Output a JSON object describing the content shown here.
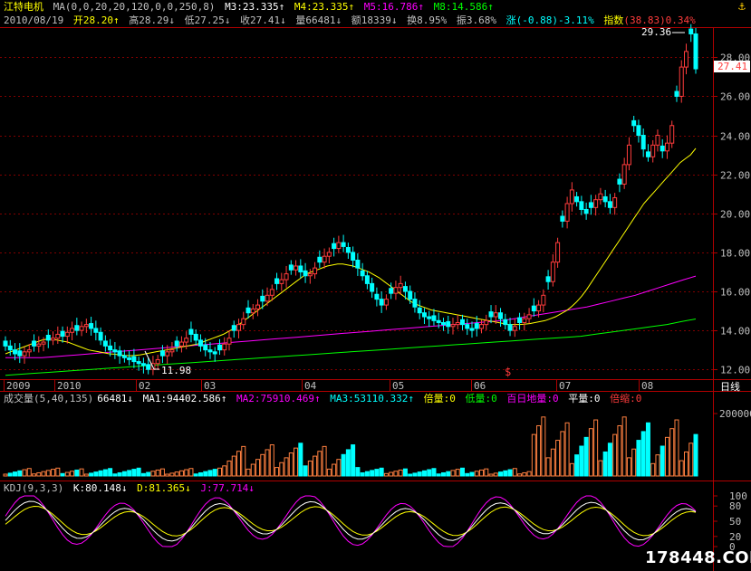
{
  "header": {
    "stock_name": "江特电机",
    "ma_params": "MA(0,0,20,20,120,0,0,250,8)",
    "ma3": "M3:23.335↑",
    "ma4": "M4:23.335↑",
    "ma5": "M5:16.786↑",
    "ma8": "M8:14.586↑"
  },
  "info_row": {
    "date": "2010/08/19",
    "open": "开28.20↑",
    "high": "高28.29↓",
    "low": "低27.25↓",
    "close": "收27.41↓",
    "volume": "量66481↓",
    "amount": "额18339↓",
    "turnover": "换8.95%",
    "amplitude": "振3.68%",
    "change": "涨(-0.88)-3.11%",
    "index_label": "指数",
    "index_value": "(38.83)0.34%"
  },
  "price_axis": [
    "28.00",
    "26.00",
    "24.00",
    "22.00",
    "20.00",
    "18.00",
    "16.00",
    "14.00",
    "12.00"
  ],
  "current_price_tag": "27.41",
  "high_annotation": "29.36",
  "low_annotation": "11.98",
  "time_axis": [
    "2009",
    "2010",
    "02",
    "03",
    "04",
    "05",
    "06",
    "07",
    "08"
  ],
  "dollar_marker": "$",
  "period_label": "日线",
  "volume_header": {
    "name": "成交量(5,40,135)",
    "value": "66481↓",
    "ma1": "MA1:94402.586↑",
    "ma2": "MA2:75910.469↑",
    "ma3": "MA3:53110.332↑",
    "double": "倍量:0",
    "low_vol": "低量:0",
    "hundred_day": "百日地量:0",
    "flat": "平量:0",
    "shrink": "倍缩:0"
  },
  "volume_axis": [
    "200000"
  ],
  "kdj_header": {
    "name": "KDJ(9,3,3)",
    "k": "K:80.148↓",
    "d": "D:81.365↓",
    "j": "J:77.714↓"
  },
  "kdj_axis": [
    "100",
    "80",
    "50",
    "20",
    "0"
  ],
  "watermark": "178448.COM",
  "colors": {
    "up": "#ff3c3c",
    "down": "#00ffff",
    "ma20": "#ffff00",
    "ma120": "#ff00ff",
    "ma250": "#00ff00",
    "grid": "#800000",
    "frame": "#b00000"
  },
  "chart_data": {
    "type": "candlestick",
    "panels": [
      "price",
      "volume",
      "kdj"
    ],
    "price_ylim": [
      11.5,
      29.5
    ],
    "months": [
      "2009",
      "2010",
      "02",
      "03",
      "04",
      "05",
      "06",
      "07",
      "08"
    ],
    "closes": [
      13.2,
      13.0,
      12.8,
      12.7,
      12.9,
      13.0,
      13.2,
      13.3,
      13.4,
      13.5,
      13.6,
      13.8,
      13.7,
      13.9,
      14.1,
      14.0,
      14.2,
      14.3,
      14.1,
      13.9,
      13.5,
      13.2,
      13.0,
      12.9,
      12.7,
      12.6,
      12.5,
      12.4,
      12.3,
      12.2,
      12.0,
      12.3,
      12.5,
      12.7,
      12.9,
      13.0,
      13.2,
      13.4,
      13.6,
      13.8,
      13.5,
      13.2,
      13.0,
      12.9,
      12.8,
      13.0,
      13.3,
      13.6,
      14.0,
      14.3,
      14.6,
      14.9,
      15.1,
      15.3,
      15.5,
      15.8,
      16.1,
      16.4,
      16.6,
      16.9,
      17.1,
      17.3,
      17.0,
      16.8,
      16.9,
      17.2,
      17.5,
      17.8,
      18.0,
      18.2,
      18.5,
      18.3,
      18.0,
      17.6,
      17.2,
      16.8,
      16.4,
      16.0,
      15.6,
      15.3,
      15.6,
      15.9,
      16.2,
      16.4,
      16.0,
      15.6,
      15.2,
      14.9,
      14.7,
      14.6,
      14.5,
      14.4,
      14.3,
      14.2,
      14.3,
      14.4,
      14.3,
      14.1,
      14.0,
      14.1,
      14.3,
      14.5,
      14.7,
      14.9,
      14.6,
      14.3,
      14.0,
      14.2,
      14.4,
      14.6,
      14.8,
      15.0,
      15.3,
      15.8,
      16.5,
      17.5,
      18.5,
      19.6,
      20.5,
      21.2,
      20.6,
      20.2,
      20.0,
      20.3,
      20.7,
      21.0,
      20.6,
      20.3,
      20.8,
      21.5,
      22.5,
      23.5,
      24.5,
      24.0,
      23.3,
      22.9,
      23.5,
      24.0,
      23.2,
      23.6,
      24.5,
      26.0,
      27.5,
      28.3,
      29.2,
      27.41
    ],
    "ma20": [
      12.8,
      12.9,
      13.0,
      13.1,
      13.2,
      13.3,
      13.4,
      13.5,
      13.55,
      13.55,
      13.5,
      13.45,
      13.4,
      13.3,
      13.2,
      13.1,
      13.0,
      12.95,
      12.9,
      12.85,
      12.8,
      12.78,
      12.75,
      12.72,
      12.7,
      12.72,
      12.75,
      12.8,
      12.85,
      12.9,
      12.95,
      13.0,
      13.05,
      13.1,
      13.15,
      13.2,
      13.25,
      13.3,
      13.4,
      13.5,
      13.6,
      13.7,
      13.8,
      13.95,
      14.1,
      14.3,
      14.5,
      14.7,
      14.9,
      15.1,
      15.3,
      15.5,
      15.7,
      15.9,
      16.1,
      16.3,
      16.5,
      16.7,
      16.9,
      17.0,
      17.1,
      17.2,
      17.3,
      17.35,
      17.4,
      17.4,
      17.35,
      17.3,
      17.2,
      17.1,
      17.0,
      16.85,
      16.7,
      16.5,
      16.3,
      16.1,
      15.9,
      15.7,
      15.5,
      15.35,
      15.25,
      15.15,
      15.05,
      15.0,
      14.95,
      14.9,
      14.85,
      14.8,
      14.75,
      14.7,
      14.65,
      14.6,
      14.55,
      14.5,
      14.45,
      14.4,
      14.35,
      14.3,
      14.3,
      14.3,
      14.32,
      14.35,
      14.4,
      14.45,
      14.5,
      14.6,
      14.7,
      14.85,
      15.0,
      15.2,
      15.45,
      15.75,
      16.1,
      16.5,
      16.9,
      17.3,
      17.7,
      18.1,
      18.5,
      18.9,
      19.3,
      19.7,
      20.1,
      20.5,
      20.8,
      21.1,
      21.4,
      21.7,
      22.0,
      22.3,
      22.6,
      22.8,
      23.0,
      23.335
    ],
    "ma120": [
      12.6,
      12.6,
      12.6,
      12.6,
      12.65,
      12.7,
      12.75,
      12.8,
      12.85,
      12.9,
      12.95,
      13.0,
      13.05,
      13.1,
      13.15,
      13.2,
      13.25,
      13.3,
      13.35,
      13.4,
      13.45,
      13.5,
      13.55,
      13.6,
      13.65,
      13.7,
      13.75,
      13.8,
      13.85,
      13.9,
      13.95,
      14.0,
      14.05,
      14.1,
      14.15,
      14.2,
      14.25,
      14.3,
      14.35,
      14.4,
      14.45,
      14.5,
      14.6,
      14.7,
      14.8,
      14.9,
      15.0,
      15.1,
      15.2,
      15.35,
      15.5,
      15.65,
      15.8,
      16.0,
      16.2,
      16.4,
      16.6,
      16.786
    ],
    "ma250": [
      11.7,
      11.75,
      11.8,
      11.85,
      11.9,
      11.95,
      12.0,
      12.05,
      12.1,
      12.15,
      12.2,
      12.25,
      12.3,
      12.35,
      12.4,
      12.45,
      12.5,
      12.55,
      12.6,
      12.65,
      12.7,
      12.75,
      12.8,
      12.85,
      12.9,
      12.95,
      13.0,
      13.05,
      13.1,
      13.15,
      13.2,
      13.25,
      13.3,
      13.35,
      13.4,
      13.45,
      13.5,
      13.55,
      13.6,
      13.65,
      13.7,
      13.8,
      13.9,
      14.0,
      14.1,
      14.2,
      14.3,
      14.45,
      14.586
    ]
  }
}
